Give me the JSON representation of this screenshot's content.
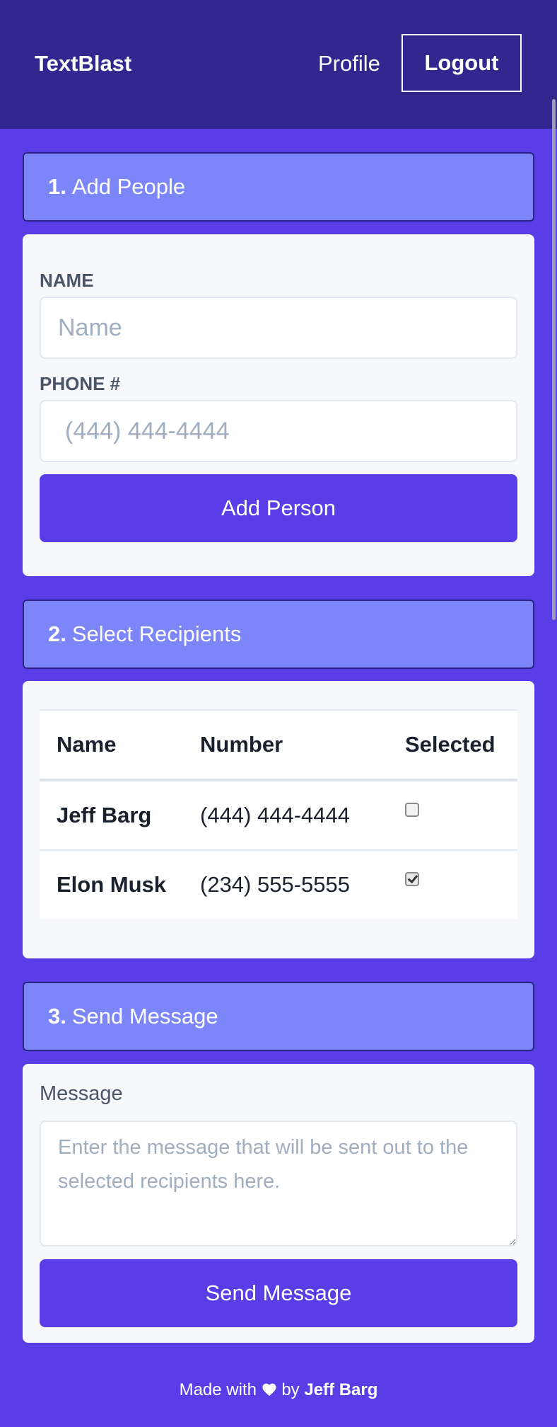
{
  "app": {
    "brand": "TextBlast"
  },
  "nav": {
    "profile_label": "Profile",
    "logout_label": "Logout"
  },
  "sections": {
    "add_people": {
      "number": "1.",
      "title": "Add People"
    },
    "select_recipients": {
      "number": "2.",
      "title": "Select Recipients"
    },
    "send_message": {
      "number": "3.",
      "title": "Send Message"
    }
  },
  "add_person_form": {
    "name_label": "NAME",
    "name_placeholder": "Name",
    "name_value": "",
    "phone_label": "PHONE #",
    "phone_placeholder": "(444) 444-4444",
    "phone_value": "",
    "submit_label": "Add Person"
  },
  "recipients": {
    "columns": [
      "Name",
      "Number",
      "Selected"
    ],
    "rows": [
      {
        "name": "Jeff Barg",
        "number": "(444) 444-4444",
        "selected": false
      },
      {
        "name": "Elon Musk",
        "number": "(234) 555-5555",
        "selected": true
      }
    ]
  },
  "message_form": {
    "label": "Message",
    "placeholder": "Enter the message that will be sent out to the selected recipients here.",
    "value": "",
    "submit_label": "Send Message"
  },
  "footer": {
    "prefix": "Made with",
    "icon": "heart-icon",
    "by": "by",
    "author": "Jeff Barg"
  },
  "colors": {
    "page_background": "#5b3de8",
    "navbar": "#33278f",
    "section_header": "#7c86f8",
    "primary_button": "#5b3de8",
    "card": "#f6f8fb"
  }
}
